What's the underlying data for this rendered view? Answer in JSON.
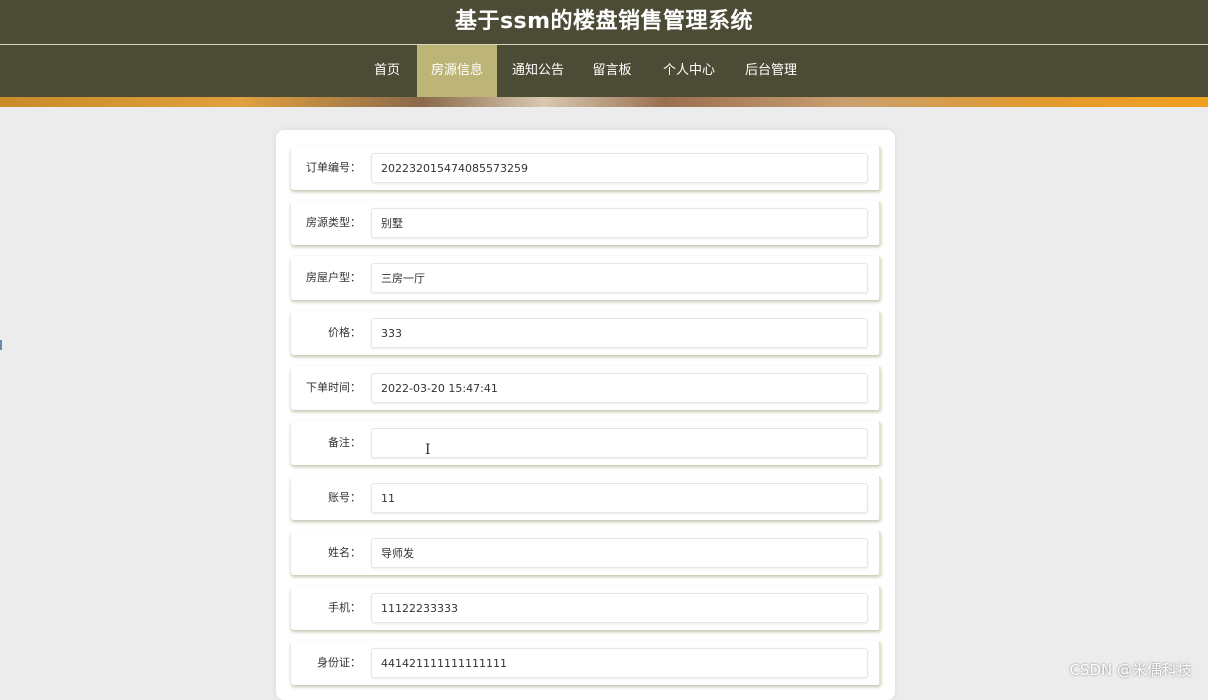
{
  "header": {
    "title": "基于ssm的楼盘销售管理系统"
  },
  "nav": {
    "items": [
      {
        "label": "首页",
        "active": false
      },
      {
        "label": "房源信息",
        "active": true
      },
      {
        "label": "通知公告",
        "active": false
      },
      {
        "label": "留言板",
        "active": false
      },
      {
        "label": "个人中心",
        "active": false
      },
      {
        "label": "后台管理",
        "active": false
      }
    ]
  },
  "form": {
    "fields": [
      {
        "label": "订单编号：",
        "value": "202232015474085573259"
      },
      {
        "label": "房源类型：",
        "value": "别墅"
      },
      {
        "label": "房屋户型：",
        "value": "三房一厅"
      },
      {
        "label": "价格：",
        "value": "333"
      },
      {
        "label": "下单时间：",
        "value": "2022-03-20 15:47:41"
      },
      {
        "label": "备注：",
        "value": ""
      },
      {
        "label": "账号：",
        "value": "11"
      },
      {
        "label": "姓名：",
        "value": "导师发"
      },
      {
        "label": "手机：",
        "value": "11122233333"
      },
      {
        "label": "身份证：",
        "value": "441421111111111111"
      }
    ]
  },
  "watermark": "CSDN @米偶科技",
  "colors": {
    "header_bg": "#4c4b36",
    "nav_active": "#bdb578",
    "page_bg": "#ececec"
  }
}
